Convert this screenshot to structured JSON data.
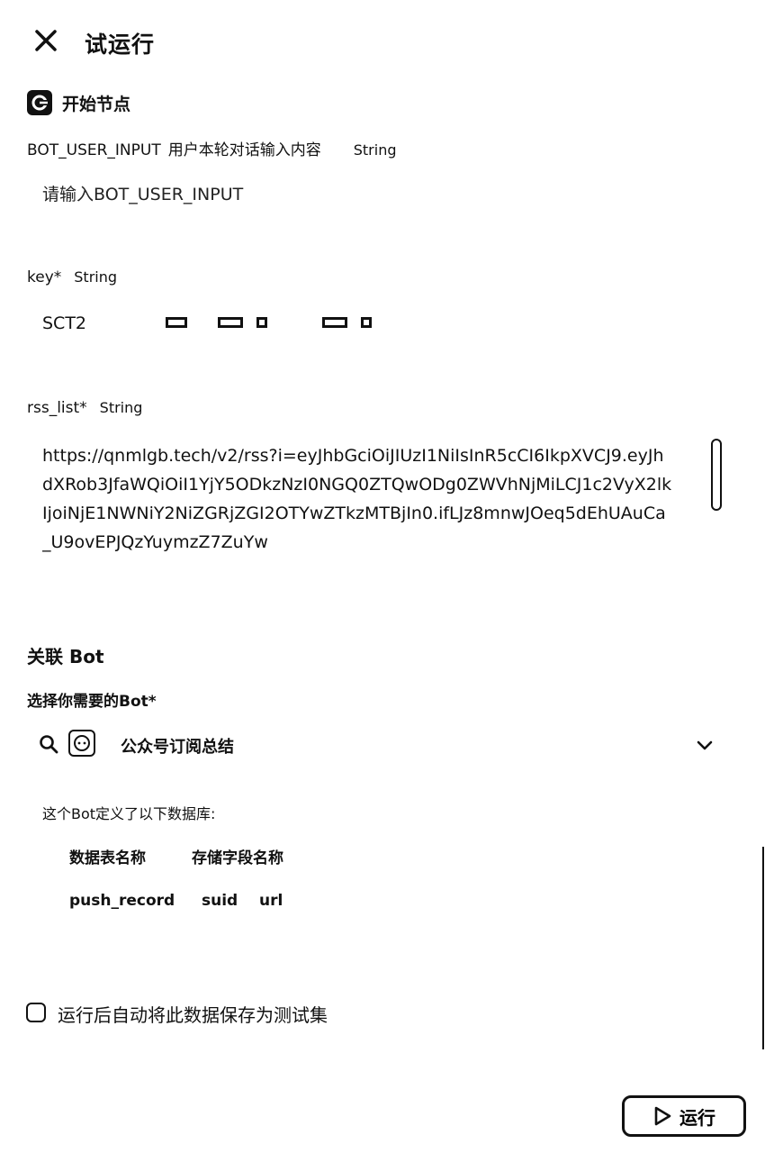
{
  "header": {
    "title": "试运行"
  },
  "start_node": {
    "title": "开始节点",
    "fields": {
      "bot_user_input": {
        "name": "BOT_USER_INPUT",
        "description": "用户本轮对话输入内容",
        "type": "String",
        "placeholder": "请输入BOT_USER_INPUT",
        "value": ""
      },
      "key": {
        "name": "key*",
        "type": "String",
        "value_visible_prefix": "SCT2"
      },
      "rss_list": {
        "name": "rss_list*",
        "type": "String",
        "value": "https://qnmlgb.tech/v2/rss?i=eyJhbGciOiJIUzI1NiIsInR5cCI6IkpXVCJ9.eyJhdXRob3JfaWQiOiI1YjY5ODkzNzI0NGQ0ZTQwODg0ZWVhNjMiLCJ1c2VyX2lkIjoiNjE1NWNiY2NiZGRjZGI2OTYwZTkzMTBjIn0.ifLJz8mnwJOeq5dEhUAuCa_U9ovEPJQzYuymzZ7ZuYw"
      }
    }
  },
  "related_bot": {
    "title": "关联 Bot",
    "select_label": "选择你需要的Bot*",
    "selected_bot": "公众号订阅总结",
    "db_intro": "这个Bot定义了以下数据库:",
    "table_headers": [
      "数据表名称",
      "存储字段名称"
    ],
    "table_row": {
      "table_name": "push_record",
      "fields": [
        "suid",
        "url"
      ]
    }
  },
  "footer": {
    "save_checkbox_label": "运行后自动将此数据保存为测试集",
    "save_checkbox_checked": false,
    "run_button_label": "运行"
  },
  "icons": {
    "close": "close-icon",
    "node": "start-node-icon",
    "search": "search-icon",
    "bot_avatar": "bot-avatar-icon",
    "chevron": "chevron-down-icon",
    "play": "play-icon"
  }
}
